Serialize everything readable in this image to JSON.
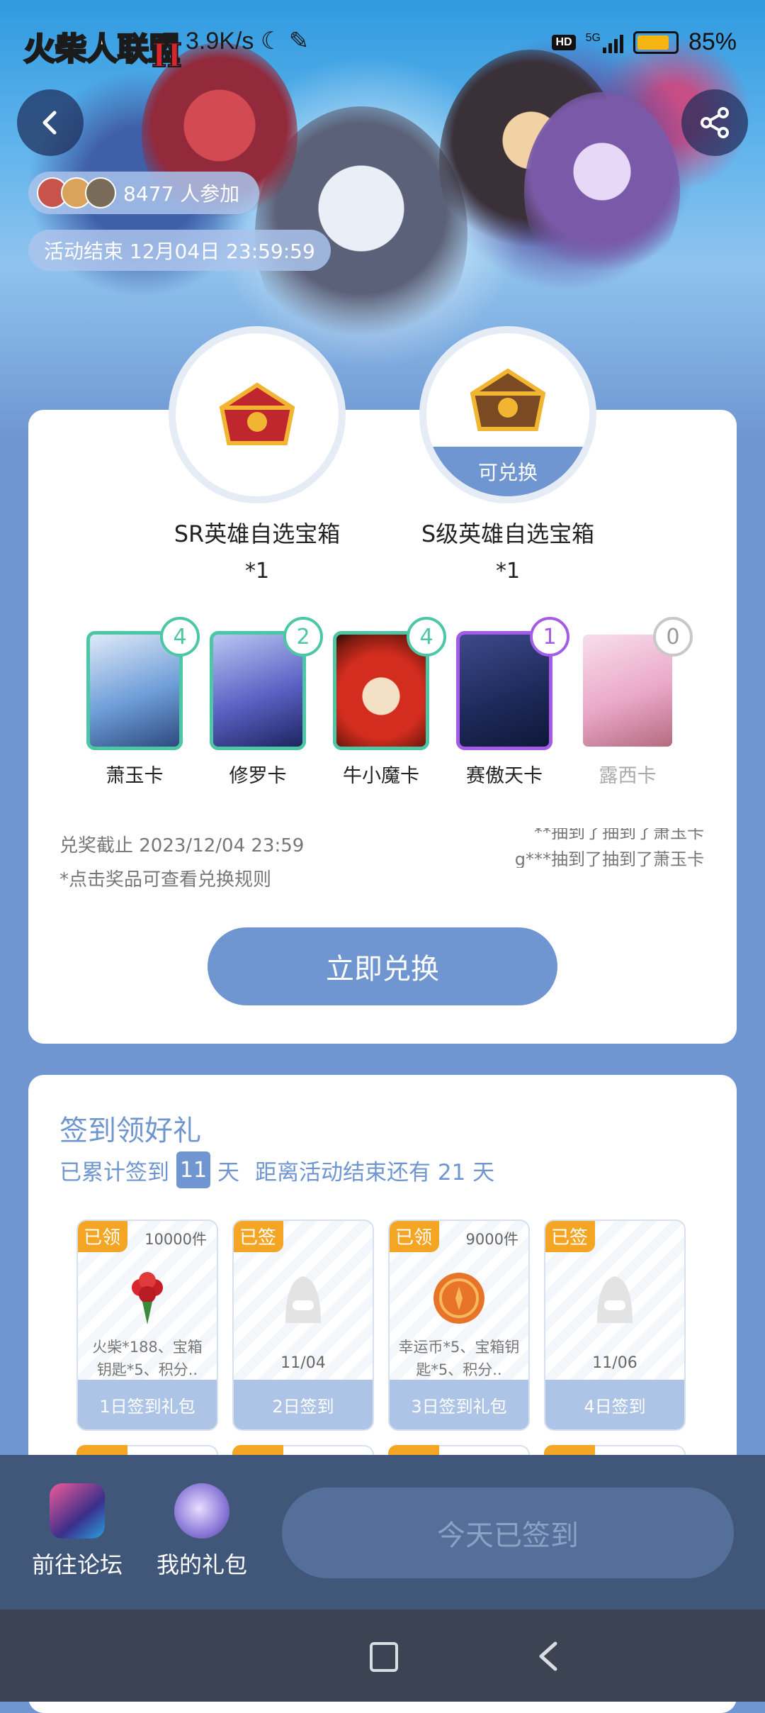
{
  "status_bar": {
    "speed": "3.9K/s",
    "network_badge": "HD",
    "network_type": "5G",
    "battery_percent": "85%",
    "battery_level": 0.85
  },
  "hero": {
    "game_logo_text": "火柴人联盟",
    "game_logo_mark": "II",
    "participants": "8477 人参加",
    "end_time": "活动结束 12月04日 23:59:59"
  },
  "prizes": [
    {
      "name": "SR英雄自选宝箱",
      "qty": "*1",
      "badge": ""
    },
    {
      "name": "S级英雄自选宝箱",
      "qty": "*1",
      "badge": "可兑换"
    }
  ],
  "hero_cards": [
    {
      "name": "萧玉卡",
      "count": "4",
      "color": "#4cc6a4"
    },
    {
      "name": "修罗卡",
      "count": "2",
      "color": "#4cc6a4"
    },
    {
      "name": "牛小魔卡",
      "count": "4",
      "color": "#4cc6a4"
    },
    {
      "name": "赛傲天卡",
      "count": "1",
      "color": "#a45ce6"
    },
    {
      "name": "露西卡",
      "count": "0",
      "color": "#c8c8c8"
    }
  ],
  "exchange": {
    "deadline": "兑奖截止 2023/12/04 23:59",
    "rule_tip": "*点击奖品可查看兑换规则",
    "marquee_1": "**抽到了抽到了萧玉卡",
    "marquee_2": "g***抽到了抽到了萧玉卡",
    "redeem_button": "立即兑换"
  },
  "signin": {
    "title": "签到领好礼",
    "sub_prefix": "已累计签到",
    "days_signed": "11",
    "sub_suffix": "天",
    "remain_text": "距离活动结束还有 21 天",
    "days": [
      {
        "tag": "已领",
        "stock": "10000件",
        "desc": "火柴*188、宝箱钥匙*5、积分..",
        "date": "",
        "label": "1日签到礼包",
        "icon": "bouquet-icon"
      },
      {
        "tag": "已签",
        "stock": "",
        "desc": "",
        "date": "11/04",
        "label": "2日签到",
        "icon": "placeholder-icon"
      },
      {
        "tag": "已领",
        "stock": "9000件",
        "desc": "幸运币*5、宝箱钥匙*5、积分..",
        "date": "",
        "label": "3日签到礼包",
        "icon": "coin-icon"
      },
      {
        "tag": "已签",
        "stock": "",
        "desc": "",
        "date": "11/06",
        "label": "4日签到",
        "icon": "placeholder-icon"
      }
    ]
  },
  "bottom_bar": {
    "forum": "前往论坛",
    "my_gifts": "我的礼包",
    "signed_today": "今天已签到"
  },
  "colors": {
    "primary": "#6f96d1",
    "tag_orange": "#f5a524",
    "card_green": "#4cc6a4",
    "card_purple": "#a45ce6",
    "bottom_bar": "#40577a"
  }
}
